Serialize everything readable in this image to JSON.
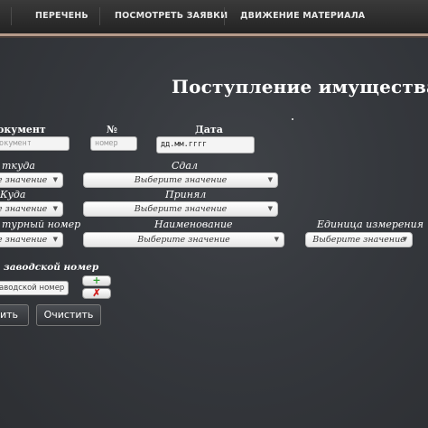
{
  "nav": {
    "items": [
      "ПЕРЕЧЕНЬ",
      "ПОСМОТРЕТЬ ЗАЯВКИ",
      "ДВИЖЕНИЕ МАТЕРИАЛА"
    ],
    "active_color": "#b59a8a"
  },
  "page_title": "Поступление имущества",
  "form": {
    "document": {
      "label": "окумент",
      "placeholder": "окумент"
    },
    "number": {
      "label": "№",
      "placeholder": "номер"
    },
    "date": {
      "label": "Дата",
      "value": "дд.мм.гггг"
    },
    "from": {
      "label": "ткуда",
      "value": "е значение"
    },
    "handed_over": {
      "label": "Сдал",
      "value": "Выберите значение"
    },
    "to": {
      "label": "Куда",
      "value": "е значение"
    },
    "accepted": {
      "label": "Принял",
      "value": "Выберите значение"
    },
    "inventory_number": {
      "label": "турный номер",
      "value": "е значение"
    },
    "name": {
      "label": "Наименование",
      "value": "Выберите значение"
    },
    "unit": {
      "label": "Единица измерения",
      "value": "Выберите значение"
    },
    "serial_number": {
      "label": "заводской номер",
      "placeholder": "аводской номер"
    },
    "add_icon": "+",
    "remove_icon": "✗"
  },
  "buttons": {
    "submit": "ить",
    "clear": "Очистить"
  },
  "colors": {
    "add": "#2e9e2e",
    "remove": "#d02020"
  }
}
